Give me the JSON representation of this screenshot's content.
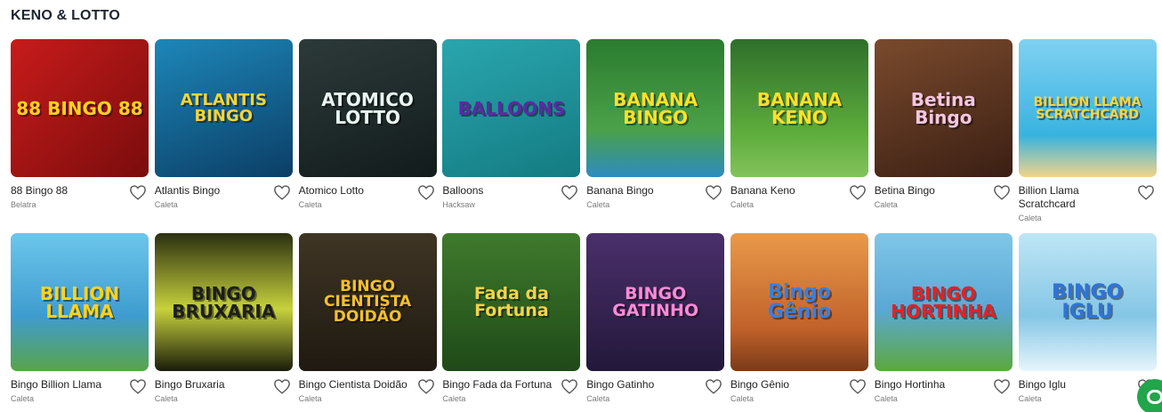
{
  "section": {
    "title": "KENO & LOTTO"
  },
  "games": [
    {
      "name": "88 Bingo 88",
      "provider": "Belatra",
      "art": "88 BINGO 88",
      "bg": "linear-gradient(135deg,#c81b1b,#7a0c0c)",
      "fg": "#ffd21f",
      "fs": "20px"
    },
    {
      "name": "Atlantis Bingo",
      "provider": "Caleta",
      "art": "ATLANTIS BINGO",
      "bg": "linear-gradient(160deg,#1d87b9,#0b3e66)",
      "fg": "#f4d43a",
      "fs": "18px"
    },
    {
      "name": "Atomico Lotto",
      "provider": "Caleta",
      "art": "ATOMICO LOTTO",
      "bg": "linear-gradient(160deg,#2d3a3a,#121b1b)",
      "fg": "#e9f6f2",
      "fs": "20px"
    },
    {
      "name": "Balloons",
      "provider": "Hacksaw",
      "art": "BALLOONS",
      "bg": "linear-gradient(160deg,#2aa6ae,#147b82)",
      "fg": "#5b2aa6",
      "fs": "20px"
    },
    {
      "name": "Banana Bingo",
      "provider": "Caleta",
      "art": "BANANA BINGO",
      "bg": "linear-gradient(180deg,#2a7b2f,#4ba148 65%,#2d8cc0)",
      "fg": "#ffe02a",
      "fs": "20px"
    },
    {
      "name": "Banana Keno",
      "provider": "Caleta",
      "art": "BANANA KENO",
      "bg": "linear-gradient(180deg,#2e6f2a,#5fae3d 70%,#83c35b)",
      "fg": "#ffe02a",
      "fs": "20px"
    },
    {
      "name": "Betina Bingo",
      "provider": "Caleta",
      "art": "Betina Bingo",
      "bg": "linear-gradient(160deg,#7a4a2c,#3b1f14)",
      "fg": "#f5c6e2",
      "fs": "20px"
    },
    {
      "name": "Billion Llama Scratchcard",
      "provider": "Caleta",
      "art": "BILLION LLAMA SCRATCHCARD",
      "bg": "linear-gradient(180deg,#7fd1f2,#38b3e0 70%,#f2d48a)",
      "fg": "#ffd53a",
      "fs": "14px"
    },
    {
      "name": "Bingo Billion Llama",
      "provider": "Caleta",
      "art": "BILLION LLAMA",
      "bg": "linear-gradient(180deg,#6cc6ec,#3f9ccf 60%,#5aa34b)",
      "fg": "#ffd21f",
      "fs": "20px"
    },
    {
      "name": "Bingo Bruxaria",
      "provider": "Caleta",
      "art": "BINGO BRUXARIA",
      "bg": "linear-gradient(180deg,#2b2f10,#c7d23c 55%,#1a1c0a)",
      "fg": "#1d1d1d",
      "fs": "20px"
    },
    {
      "name": "Bingo Cientista Doidão",
      "provider": "Caleta",
      "art": "BINGO CIENTISTA DOIDÃO",
      "bg": "linear-gradient(180deg,#3f3524,#1f1911)",
      "fg": "#f3c02a",
      "fs": "17px"
    },
    {
      "name": "Bingo Fada da Fortuna",
      "provider": "Caleta",
      "art": "Fada da Fortuna",
      "bg": "linear-gradient(180deg,#3f7a2c,#1f4a18)",
      "fg": "#f5d34a",
      "fs": "19px"
    },
    {
      "name": "Bingo Gatinho",
      "provider": "Caleta",
      "art": "BINGO GATINHO",
      "bg": "linear-gradient(180deg,#4a2f6b,#23183a)",
      "fg": "#ff8ad8",
      "fs": "19px"
    },
    {
      "name": "Bingo Gênio",
      "provider": "Caleta",
      "art": "Bingo Gênio",
      "bg": "linear-gradient(180deg,#e99a4a,#c0612a 70%,#7a3a1a)",
      "fg": "#3a7ee0",
      "fs": "22px"
    },
    {
      "name": "Bingo Hortinha",
      "provider": "Caleta",
      "art": "BINGO HORTINHA",
      "bg": "linear-gradient(180deg,#7fc6e8,#5ba8d6 55%,#5ca83c)",
      "fg": "#e32222",
      "fs": "20px"
    },
    {
      "name": "Bingo Iglu",
      "provider": "Caleta",
      "art": "BINGO IGLU",
      "bg": "linear-gradient(180deg,#bfe6f5,#84c6e6 60%,#e7f5fb)",
      "fg": "#2f73d6",
      "fs": "22px"
    }
  ]
}
